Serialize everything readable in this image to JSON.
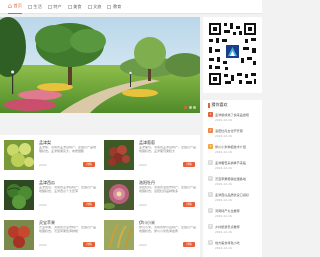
{
  "nav": {
    "items": [
      {
        "label": "首页",
        "icon": "home-icon",
        "active": true
      },
      {
        "label": "生活",
        "icon": "book-icon",
        "active": false
      },
      {
        "label": "特产",
        "icon": "book-icon",
        "active": false
      },
      {
        "label": "美食",
        "icon": "book-icon",
        "active": false
      },
      {
        "label": "文旅",
        "icon": "book-icon",
        "active": false
      },
      {
        "label": "教育",
        "icon": "book-icon",
        "active": false
      }
    ]
  },
  "colors": {
    "accent": "#e5613a"
  },
  "products": [
    {
      "title": "孟津梨",
      "desc": "孟津梨，河南省孟津县特产，全国农产品地理标志。孟津梨果实大，肉质细脆",
      "date": "2022",
      "more": "详情"
    },
    {
      "title": "孟津葡萄",
      "desc": "孟津葡萄，河南省孟津县特产，全国农产品地理标志。孟津葡萄果粒大",
      "date": "2022",
      "more": "详情"
    },
    {
      "title": "孟津西瓜",
      "desc": "孟津西瓜，河南省孟津县特产，全国农产品地理标志。孟津西瓜个大皮薄",
      "date": "2022",
      "more": "详情"
    },
    {
      "title": "洛阳牡丹",
      "desc": "洛阳牡丹，河南省洛阳市特产，全国农产品地理标志。洛阳牡丹品种繁多",
      "date": "2022",
      "more": "详情"
    },
    {
      "title": "灵宝苹果",
      "desc": "灵宝苹果，河南省灵宝市特产，全国农产品地理标志。灵宝苹果色泽鲜艳",
      "date": "2022",
      "more": "详情"
    },
    {
      "title": "伊川小米",
      "desc": "伊川小米，河南省伊川县特产，全国农产品地理标志。伊川小米色泽金黄",
      "date": "2022",
      "more": "详情"
    }
  ],
  "hot": {
    "heading": "猜你喜欢",
    "items": [
      {
        "num": "1",
        "title": "孟津梨成熟了快来品尝吧",
        "date": "2022-12-16"
      },
      {
        "num": "2",
        "title": "洛阳牡丹文化节开幕",
        "date": "2022-12-16"
      },
      {
        "num": "3",
        "title": "伊川小米种植技术介绍",
        "date": "2022-12-16"
      },
      {
        "num": "4",
        "title": "孟津葡萄采摘季节来临",
        "date": "2022-12-16"
      },
      {
        "num": "5",
        "title": "灵宝苹果畅销全国各地",
        "date": "2022-12-16"
      },
      {
        "num": "6",
        "title": "孟津西瓜品质优良口感好",
        "date": "2022-12-16"
      },
      {
        "num": "7",
        "title": "河南特产大全推荐",
        "date": "2022-12-16"
      },
      {
        "num": "8",
        "title": "乡村旅游景点推荐",
        "date": "2022-12-16"
      },
      {
        "num": "9",
        "title": "地方美食特色小吃",
        "date": "2022-12-16"
      }
    ]
  }
}
